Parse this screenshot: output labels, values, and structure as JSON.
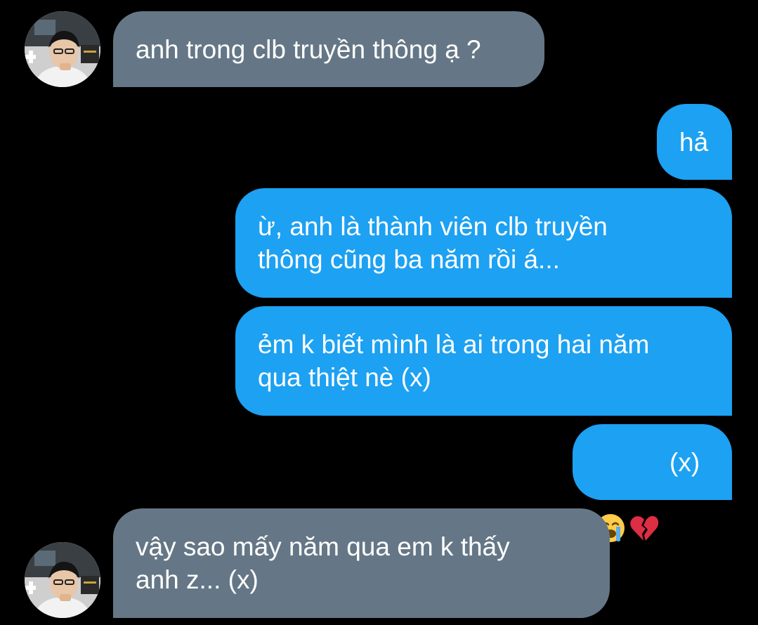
{
  "conversation": {
    "messages": [
      {
        "sender": "other",
        "text": "anh trong clb truyền thông ạ ?"
      },
      {
        "sender": "me",
        "text": "hả"
      },
      {
        "sender": "me",
        "text": "ừ, anh là thành viên clb truyền\nthông cũng ba năm rồi á..."
      },
      {
        "sender": "me",
        "text": "ẻm k biết mình là ai trong hai năm\nqua thiệt nè (x)"
      },
      {
        "sender": "me",
        "text": "(x)",
        "emojis": [
          "loudly-crying-face-icon",
          "broken-heart-icon"
        ]
      },
      {
        "sender": "other",
        "text": "vậy sao mấy năm qua em k thấy\nanh z... (x)"
      }
    ]
  },
  "colors": {
    "background": "#000000",
    "incoming_bubble": "#657786",
    "outgoing_bubble": "#1da1f2",
    "text": "#ffffff"
  }
}
